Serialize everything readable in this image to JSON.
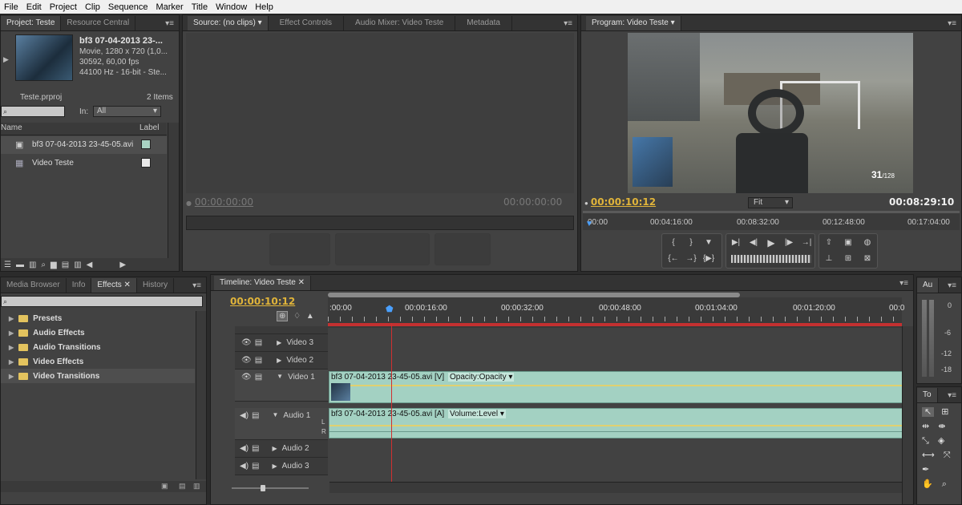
{
  "menu": [
    "File",
    "Edit",
    "Project",
    "Clip",
    "Sequence",
    "Marker",
    "Title",
    "Window",
    "Help"
  ],
  "project": {
    "tabs": [
      "Project: Teste",
      "Resource Central"
    ],
    "clip_name": "bf3 07-04-2013 23-...",
    "clip_line1": "Movie, 1280 x 720 (1,0...",
    "clip_line2": "30592, 60,00 fps",
    "clip_line3": "44100 Hz - 16-bit - Ste...",
    "project_file": "Teste.prproj",
    "item_count": "2 Items",
    "in_label": "In:",
    "in_value": "All",
    "col_name": "Name",
    "col_label": "Label",
    "items": [
      {
        "name": "bf3 07-04-2013 23-45-05.avi",
        "color": "#a8d2c2"
      },
      {
        "name": "Video Teste",
        "color": "#e8e8e8"
      }
    ]
  },
  "source": {
    "tabs": [
      "Source: (no clips)",
      "Effect Controls",
      "Audio Mixer: Video Teste",
      "Metadata"
    ],
    "tc_left": "00:00:00:00",
    "tc_right": "00:00:00:00"
  },
  "program": {
    "tab": "Program: Video Teste",
    "tc_current": "00:00:10:12",
    "fit": "Fit",
    "tc_duration": "00:08:29:10",
    "ruler": [
      "00:00",
      "00:04:16:00",
      "00:08:32:00",
      "00:12:48:00",
      "00:17:04:00"
    ],
    "hud_ammo": "31",
    "hud_reserve": "/128"
  },
  "effects": {
    "tabs": [
      "Media Browser",
      "Info",
      "Effects",
      "History"
    ],
    "folders": [
      "Presets",
      "Audio Effects",
      "Audio Transitions",
      "Video Effects",
      "Video Transitions"
    ]
  },
  "timeline": {
    "tab": "Timeline: Video Teste",
    "tc": "00:00:10:12",
    "ruler": [
      ":00:00",
      "00:00:16:00",
      "00:00:32:00",
      "00:00:48:00",
      "00:01:04:00",
      "00:01:20:00",
      "00:0"
    ],
    "tracks_video": [
      "Video 3",
      "Video 2",
      "Video 1"
    ],
    "tracks_audio": [
      "Audio 1",
      "Audio 2",
      "Audio 3"
    ],
    "video_clip": "bf3 07-04-2013 23-45-05.avi [V]",
    "video_fx": "Opacity:Opacity",
    "audio_clip": "bf3 07-04-2013 23-45-05.avi [A]",
    "audio_fx": "Volume:Level",
    "audio_ch_l": "L",
    "audio_ch_r": "R"
  },
  "audio_meter": {
    "tab": "Au",
    "marks": [
      "0",
      "-6",
      "-12",
      "-18"
    ]
  },
  "tools": {
    "tab": "To"
  }
}
